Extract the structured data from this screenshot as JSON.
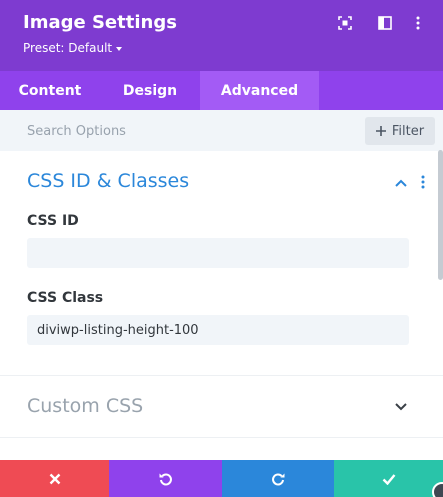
{
  "header": {
    "title": "Image Settings",
    "preset_label": "Preset: Default",
    "icons": [
      "expand-icon",
      "sidebar-toggle-icon",
      "more-options-icon"
    ],
    "bg_color": "#7e3bd0"
  },
  "tabs": [
    {
      "label": "Content",
      "active": false
    },
    {
      "label": "Design",
      "active": false
    },
    {
      "label": "Advanced",
      "active": true
    }
  ],
  "search": {
    "placeholder": "Search Options",
    "filter_label": "Filter"
  },
  "sections": {
    "css_id_classes": {
      "title": "CSS ID & Classes",
      "expanded": true,
      "fields": {
        "css_id": {
          "label": "CSS ID",
          "value": ""
        },
        "css_class": {
          "label": "CSS Class",
          "value": "diviwp-listing-height-100"
        }
      }
    },
    "custom_css": {
      "title": "Custom CSS",
      "expanded": false
    }
  },
  "footer": {
    "buttons": [
      {
        "name": "discard",
        "icon": "close-icon",
        "color": "#ef4b54"
      },
      {
        "name": "undo",
        "icon": "undo-icon",
        "color": "#8f42ec"
      },
      {
        "name": "redo",
        "icon": "redo-icon",
        "color": "#2b87da"
      },
      {
        "name": "save",
        "icon": "check-icon",
        "color": "#29c4a9"
      }
    ]
  },
  "colors": {
    "accent_blue": "#2b87da",
    "tab_bar": "#8f42ec",
    "tab_active": "#a35bf5"
  }
}
